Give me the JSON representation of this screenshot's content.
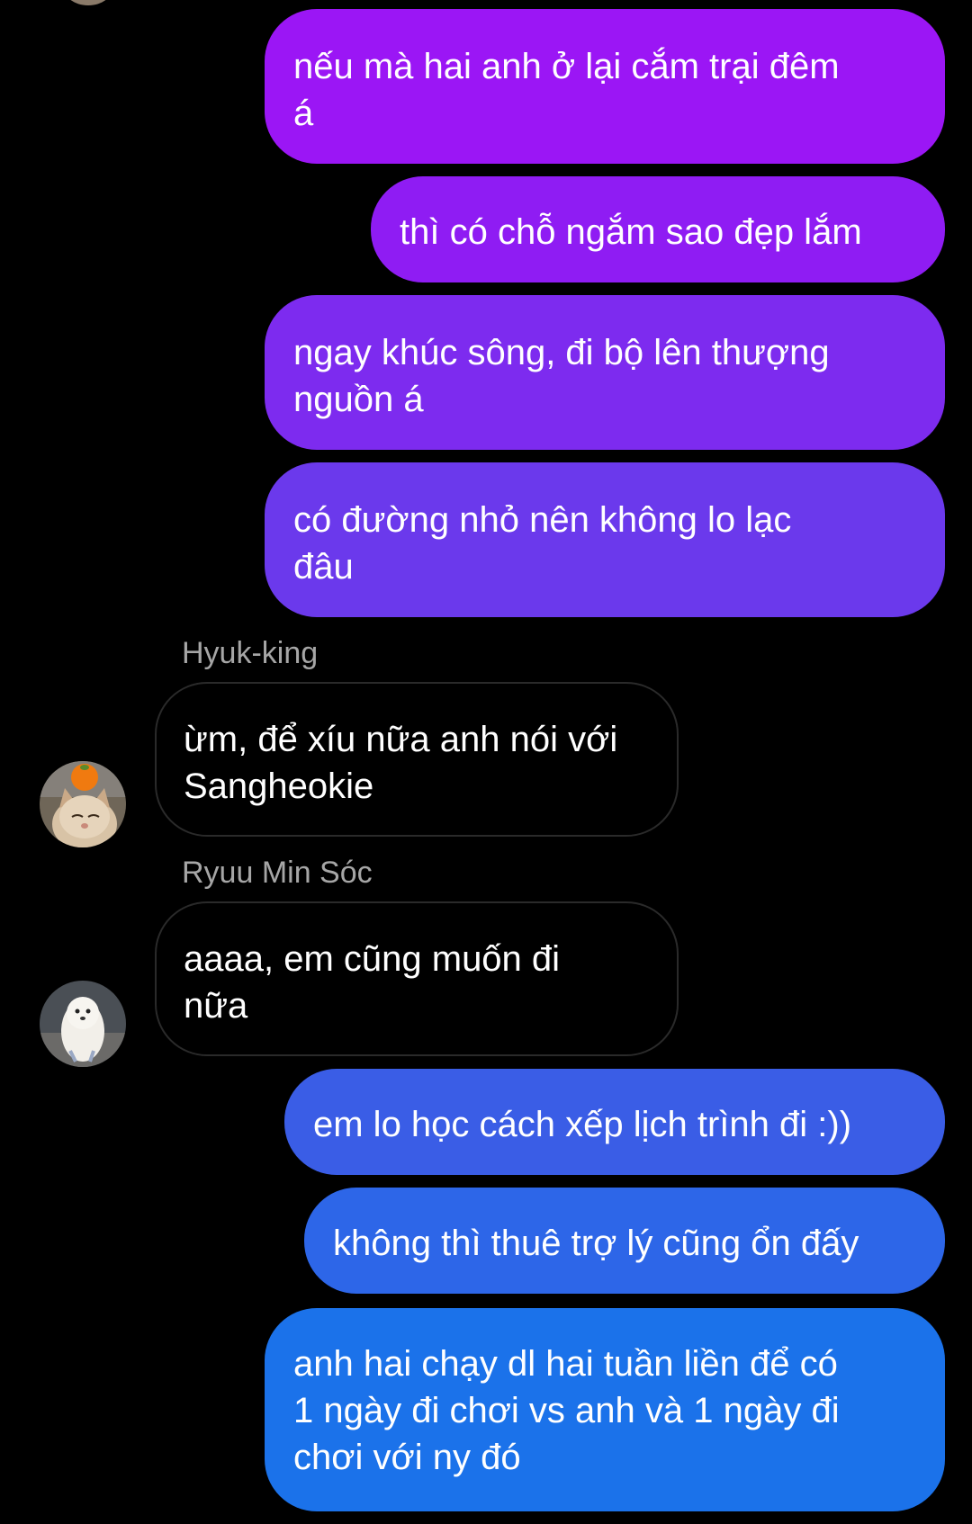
{
  "messages": [
    {
      "dir": "out",
      "text": "nếu mà hai anh ở lại cắm trại đêm\ná",
      "color": "#9b16f5"
    },
    {
      "dir": "out",
      "text": "thì có chỗ ngắm sao đẹp lắm",
      "color": "#8f1cf3"
    },
    {
      "dir": "out",
      "text": "ngay khúc sông, đi bộ lên thượng\nnguồn á",
      "color": "#7d2bef"
    },
    {
      "dir": "out",
      "text": "có đường nhỏ nên không lo lạc\nđâu",
      "color": "#6b39ec"
    },
    {
      "dir": "in",
      "sender": "Hyuk-king",
      "text": "ừm, để xíu nữa anh nói với\nSangheokie",
      "avatar": "cat-avatar"
    },
    {
      "dir": "in",
      "sender": "Ryuu Min Sóc",
      "text": "aaaa, em cũng muốn đi\nnữa",
      "avatar": "dog-avatar"
    },
    {
      "dir": "out",
      "text": "em lo học cách xếp lịch trình đi :))",
      "color": "#3a5de6"
    },
    {
      "dir": "out",
      "text": "không thì thuê trợ lý cũng ổn đấy",
      "color": "#2d66e8"
    },
    {
      "dir": "out",
      "text": "anh hai chạy dl hai tuần liền để có\n1 ngày đi chơi vs anh và 1 ngày đi\nchơi với ny đó",
      "color": "#1b72ea"
    }
  ]
}
